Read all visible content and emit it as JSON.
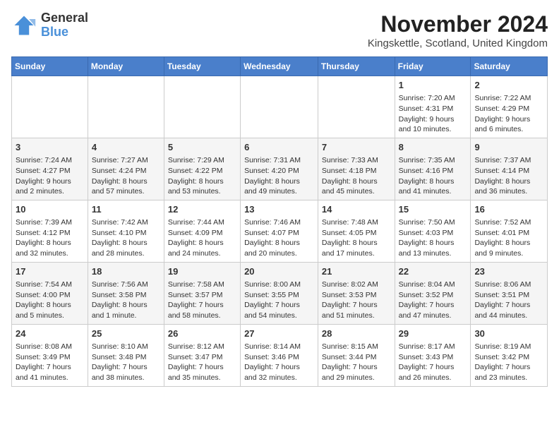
{
  "header": {
    "logo_general": "General",
    "logo_blue": "Blue",
    "month_title": "November 2024",
    "location": "Kingskettle, Scotland, United Kingdom"
  },
  "days_of_week": [
    "Sunday",
    "Monday",
    "Tuesday",
    "Wednesday",
    "Thursday",
    "Friday",
    "Saturday"
  ],
  "weeks": [
    [
      {
        "day": "",
        "content": ""
      },
      {
        "day": "",
        "content": ""
      },
      {
        "day": "",
        "content": ""
      },
      {
        "day": "",
        "content": ""
      },
      {
        "day": "",
        "content": ""
      },
      {
        "day": "1",
        "content": "Sunrise: 7:20 AM\nSunset: 4:31 PM\nDaylight: 9 hours and 10 minutes."
      },
      {
        "day": "2",
        "content": "Sunrise: 7:22 AM\nSunset: 4:29 PM\nDaylight: 9 hours and 6 minutes."
      }
    ],
    [
      {
        "day": "3",
        "content": "Sunrise: 7:24 AM\nSunset: 4:27 PM\nDaylight: 9 hours and 2 minutes."
      },
      {
        "day": "4",
        "content": "Sunrise: 7:27 AM\nSunset: 4:24 PM\nDaylight: 8 hours and 57 minutes."
      },
      {
        "day": "5",
        "content": "Sunrise: 7:29 AM\nSunset: 4:22 PM\nDaylight: 8 hours and 53 minutes."
      },
      {
        "day": "6",
        "content": "Sunrise: 7:31 AM\nSunset: 4:20 PM\nDaylight: 8 hours and 49 minutes."
      },
      {
        "day": "7",
        "content": "Sunrise: 7:33 AM\nSunset: 4:18 PM\nDaylight: 8 hours and 45 minutes."
      },
      {
        "day": "8",
        "content": "Sunrise: 7:35 AM\nSunset: 4:16 PM\nDaylight: 8 hours and 41 minutes."
      },
      {
        "day": "9",
        "content": "Sunrise: 7:37 AM\nSunset: 4:14 PM\nDaylight: 8 hours and 36 minutes."
      }
    ],
    [
      {
        "day": "10",
        "content": "Sunrise: 7:39 AM\nSunset: 4:12 PM\nDaylight: 8 hours and 32 minutes."
      },
      {
        "day": "11",
        "content": "Sunrise: 7:42 AM\nSunset: 4:10 PM\nDaylight: 8 hours and 28 minutes."
      },
      {
        "day": "12",
        "content": "Sunrise: 7:44 AM\nSunset: 4:09 PM\nDaylight: 8 hours and 24 minutes."
      },
      {
        "day": "13",
        "content": "Sunrise: 7:46 AM\nSunset: 4:07 PM\nDaylight: 8 hours and 20 minutes."
      },
      {
        "day": "14",
        "content": "Sunrise: 7:48 AM\nSunset: 4:05 PM\nDaylight: 8 hours and 17 minutes."
      },
      {
        "day": "15",
        "content": "Sunrise: 7:50 AM\nSunset: 4:03 PM\nDaylight: 8 hours and 13 minutes."
      },
      {
        "day": "16",
        "content": "Sunrise: 7:52 AM\nSunset: 4:01 PM\nDaylight: 8 hours and 9 minutes."
      }
    ],
    [
      {
        "day": "17",
        "content": "Sunrise: 7:54 AM\nSunset: 4:00 PM\nDaylight: 8 hours and 5 minutes."
      },
      {
        "day": "18",
        "content": "Sunrise: 7:56 AM\nSunset: 3:58 PM\nDaylight: 8 hours and 1 minute."
      },
      {
        "day": "19",
        "content": "Sunrise: 7:58 AM\nSunset: 3:57 PM\nDaylight: 7 hours and 58 minutes."
      },
      {
        "day": "20",
        "content": "Sunrise: 8:00 AM\nSunset: 3:55 PM\nDaylight: 7 hours and 54 minutes."
      },
      {
        "day": "21",
        "content": "Sunrise: 8:02 AM\nSunset: 3:53 PM\nDaylight: 7 hours and 51 minutes."
      },
      {
        "day": "22",
        "content": "Sunrise: 8:04 AM\nSunset: 3:52 PM\nDaylight: 7 hours and 47 minutes."
      },
      {
        "day": "23",
        "content": "Sunrise: 8:06 AM\nSunset: 3:51 PM\nDaylight: 7 hours and 44 minutes."
      }
    ],
    [
      {
        "day": "24",
        "content": "Sunrise: 8:08 AM\nSunset: 3:49 PM\nDaylight: 7 hours and 41 minutes."
      },
      {
        "day": "25",
        "content": "Sunrise: 8:10 AM\nSunset: 3:48 PM\nDaylight: 7 hours and 38 minutes."
      },
      {
        "day": "26",
        "content": "Sunrise: 8:12 AM\nSunset: 3:47 PM\nDaylight: 7 hours and 35 minutes."
      },
      {
        "day": "27",
        "content": "Sunrise: 8:14 AM\nSunset: 3:46 PM\nDaylight: 7 hours and 32 minutes."
      },
      {
        "day": "28",
        "content": "Sunrise: 8:15 AM\nSunset: 3:44 PM\nDaylight: 7 hours and 29 minutes."
      },
      {
        "day": "29",
        "content": "Sunrise: 8:17 AM\nSunset: 3:43 PM\nDaylight: 7 hours and 26 minutes."
      },
      {
        "day": "30",
        "content": "Sunrise: 8:19 AM\nSunset: 3:42 PM\nDaylight: 7 hours and 23 minutes."
      }
    ]
  ]
}
